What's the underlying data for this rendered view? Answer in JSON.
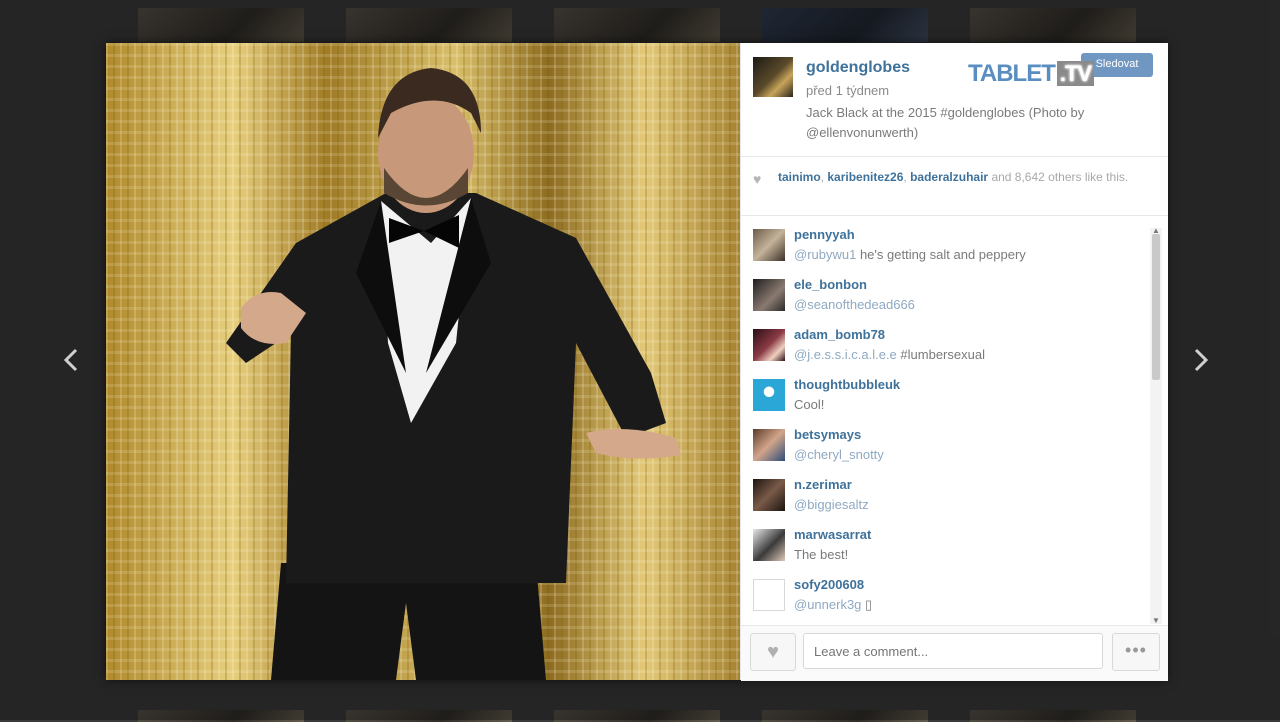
{
  "post": {
    "owner": "goldenglobes",
    "time": "před 1 týdnem",
    "caption": "Jack Black at the 2015 #goldenglobes (Photo by @ellenvonunwerth)",
    "follow_label": "Sledovat"
  },
  "watermark": {
    "main": "TABLET",
    "suffix": ".TV"
  },
  "likes": {
    "users": [
      "tainimo",
      "karibenitez26",
      "baderalzuhair"
    ],
    "others_text": "and 8,642 others like this."
  },
  "comments": [
    {
      "user": "pennyyah",
      "mention": "@rubywu1",
      "text": " he's getting salt and peppery"
    },
    {
      "user": "ele_bonbon",
      "mention": "@seanofthedead666",
      "text": ""
    },
    {
      "user": "adam_bomb78",
      "mention": "@j.e.s.s.i.c.a.l.e.e",
      "text": " #lumbersexual"
    },
    {
      "user": "thoughtbubbleuk",
      "mention": "",
      "text": "Cool!"
    },
    {
      "user": "betsymays",
      "mention": "@cheryl_snotty",
      "text": ""
    },
    {
      "user": "n.zerimar",
      "mention": "@biggiesaltz",
      "text": ""
    },
    {
      "user": "marwasarrat",
      "mention": "",
      "text": "The best!"
    },
    {
      "user": "sofy200608",
      "mention": "@unnerk3g",
      "text": " ▯"
    }
  ],
  "input": {
    "placeholder": "Leave a comment..."
  },
  "icons": {
    "prev": "chevron-left-icon",
    "next": "chevron-right-icon",
    "heart": "heart-icon",
    "more": "more-dots-icon"
  },
  "colors": {
    "link": "#3f729b",
    "follow": "#6f97c2"
  }
}
